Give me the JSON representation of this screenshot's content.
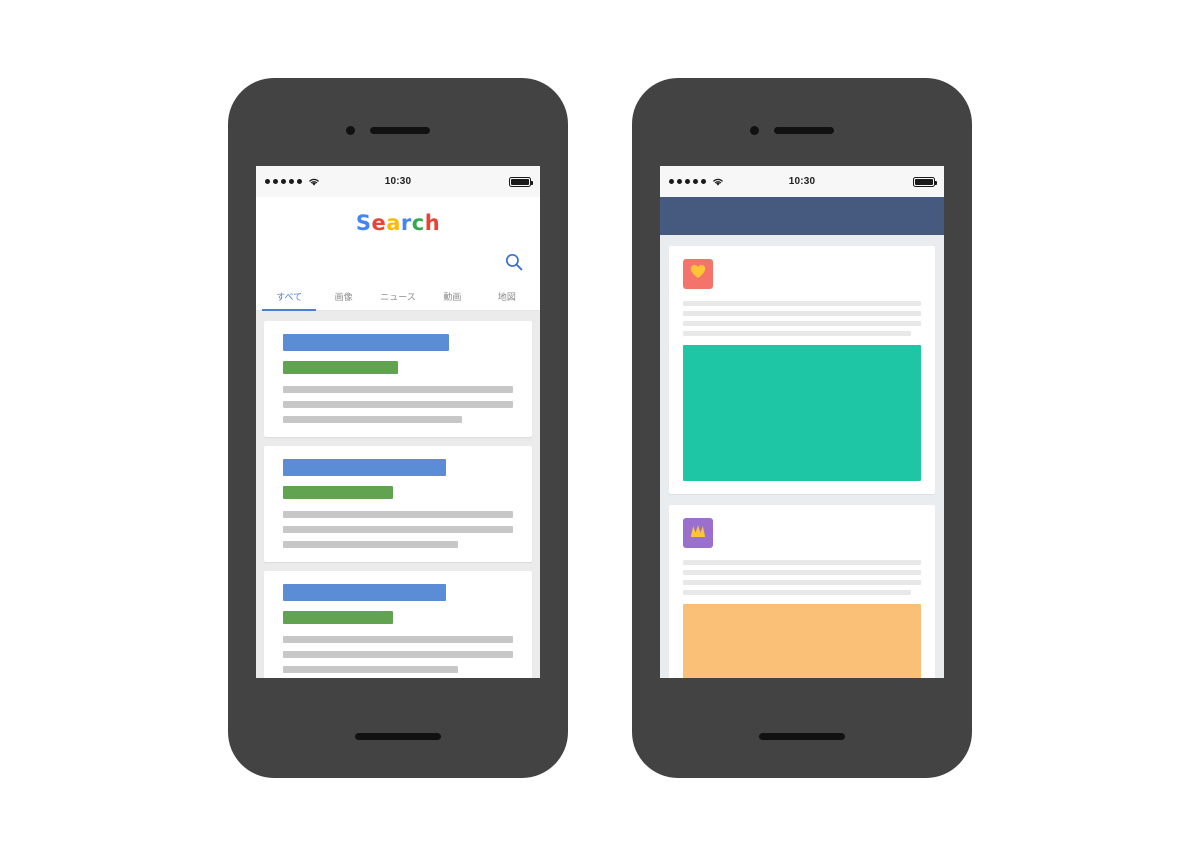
{
  "scene": {
    "background": "#ffffff",
    "device_count": 2,
    "frame_color": "#434343",
    "accent_blue": "#4a7fd4"
  },
  "status_bar": {
    "signal_dots": 5,
    "wifi_icon": "wifi-icon",
    "time": "10:30",
    "battery_icon": "battery-full-icon",
    "battery_level": 100,
    "background": "#f7f7f7"
  },
  "left_phone": {
    "device_name": "smartphone-search-app",
    "app": {
      "name": "search-app",
      "logo": {
        "text": "Search",
        "letters": [
          {
            "char": "S",
            "color": "#4285f4"
          },
          {
            "char": "e",
            "color": "#ea4335"
          },
          {
            "char": "a",
            "color": "#fbbc05"
          },
          {
            "char": "r",
            "color": "#4285f4"
          },
          {
            "char": "c",
            "color": "#34a853"
          },
          {
            "char": "h",
            "color": "#ea4335"
          }
        ]
      },
      "search": {
        "value": "",
        "placeholder": "",
        "icon": "magnifier-icon",
        "icon_color": "#3b6fd4"
      },
      "tabs": [
        {
          "label": "すべて",
          "active": true
        },
        {
          "label": "画像",
          "active": false
        },
        {
          "label": "ニュース",
          "active": false
        },
        {
          "label": "動画",
          "active": false
        },
        {
          "label": "地図",
          "active": false
        }
      ],
      "results_background": "#ebebeb",
      "colors": {
        "title_bar": "#5b8dd6",
        "url_bar": "#61a351",
        "text_line": "#c7c7c7"
      },
      "results": [
        {
          "title_width_pct": 72,
          "url_width_pct": 50,
          "line_widths_pct": [
            100,
            100,
            78
          ]
        },
        {
          "title_width_pct": 71,
          "url_width_pct": 48,
          "line_widths_pct": [
            100,
            100,
            76
          ]
        },
        {
          "title_width_pct": 71,
          "url_width_pct": 48,
          "line_widths_pct": [
            100,
            100,
            76
          ]
        }
      ]
    }
  },
  "right_phone": {
    "device_name": "smartphone-social-feed-app",
    "app": {
      "name": "social-feed-app",
      "navbar_color": "#455a7e",
      "feed_background": "#e9edf0",
      "posts": [
        {
          "avatar": {
            "icon": "heart-icon",
            "background": "#f4746b",
            "glyph_color": "#fdc536"
          },
          "line_widths_pct": [
            100,
            100,
            100,
            96
          ],
          "media": {
            "color": "#1ec6a5",
            "name": "post-image-teal"
          }
        },
        {
          "avatar": {
            "icon": "crown-icon",
            "background": "#9a6fcd",
            "glyph_color": "#fdc536"
          },
          "line_widths_pct": [
            100,
            100,
            100,
            96
          ],
          "media": {
            "color": "#fbc077",
            "name": "post-image-orange"
          }
        }
      ]
    }
  }
}
